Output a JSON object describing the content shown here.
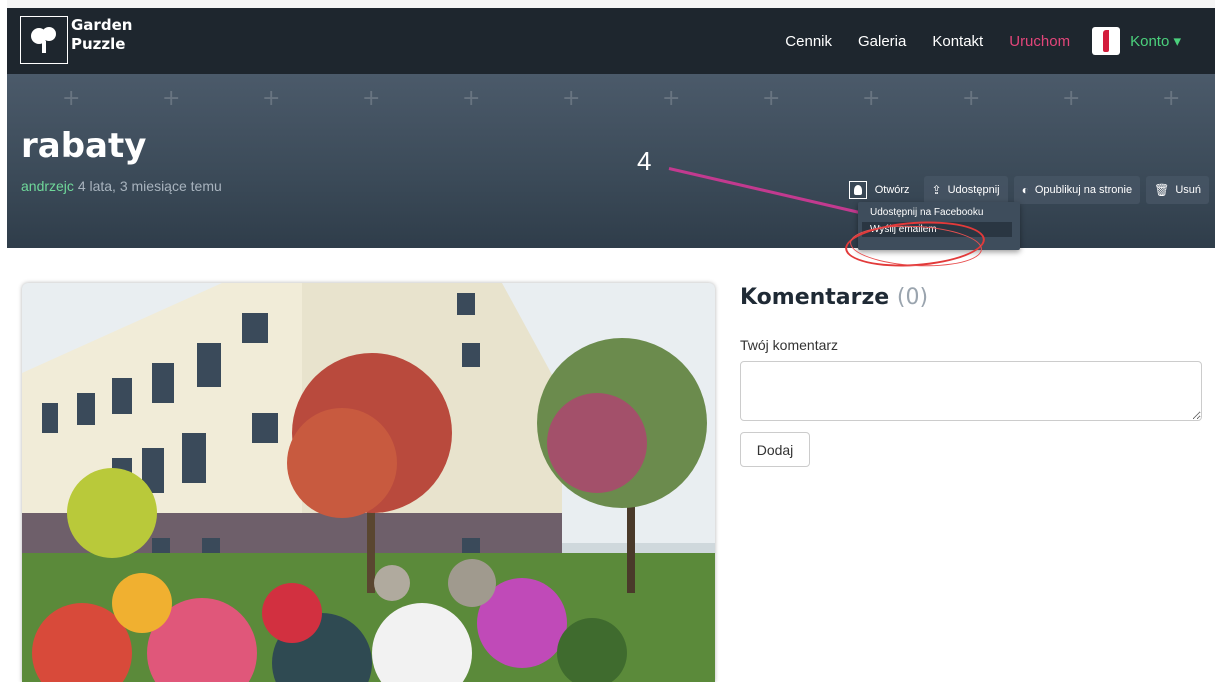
{
  "brand": {
    "line1": "Garden",
    "line2": "Puzzle"
  },
  "nav": {
    "items": [
      "Cennik",
      "Galeria",
      "Kontakt"
    ],
    "highlight": "Uruchom",
    "account": "Konto ▾"
  },
  "hero": {
    "title": "rabaty",
    "author": "andrzejc",
    "time": "4 lata, 3 miesiące temu",
    "annotation": "4"
  },
  "actions": {
    "open": "Otwórz",
    "share": "Udostępnij",
    "publish": "Opublikuj na stronie",
    "delete": "Usuń"
  },
  "share_menu": {
    "facebook": "Udostępnij na Facebooku",
    "email": "Wyślij emailem"
  },
  "comments": {
    "title": "Komentarze",
    "count": "(0)",
    "label": "Twój komentarz",
    "submit": "Dodaj"
  },
  "colors": {
    "navbar": "#1e262e",
    "accent_pink": "#e2457a",
    "accent_green": "#4bd07c"
  }
}
